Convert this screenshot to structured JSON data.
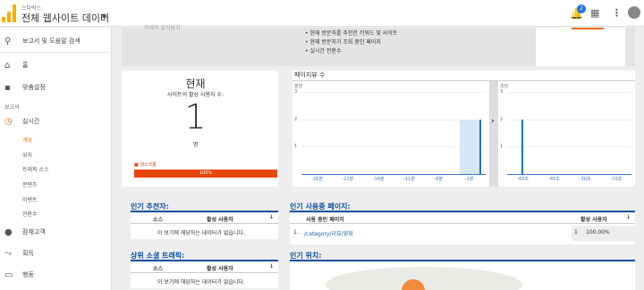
{
  "header": {
    "account_small": "스타벅스",
    "account_name": "전체 웹사이트 데이터",
    "notification_count": "2"
  },
  "sidebar": {
    "search_label": "보고서 및 도움말 검색",
    "home_label": "홈",
    "custom_label": "맞춤설정",
    "reports_heading": "보고서",
    "realtime_label": "실시간",
    "realtime_subs": [
      "개요",
      "위치",
      "트래픽 소스",
      "콘텐츠",
      "이벤트",
      "전환수"
    ],
    "audience_label": "잠재고객",
    "acquisition_label": "획득",
    "behavior_label": "행동"
  },
  "top_panel": {
    "gray_link": "자세히 알아보기",
    "bullets": [
      "현재 방문자를 추천한 키워드 및 사이트",
      "현재 방문자가 조회 중인 페이지",
      "실시간 전환수"
    ]
  },
  "now_card": {
    "title": "현재",
    "subtitle": "사이트의 활성 사용자 수:",
    "count": "1",
    "unit": "명",
    "device_label": "데스크톱",
    "device_percent": "100%",
    "device_fill": 1.0
  },
  "pageviews": {
    "title": "페이지뷰 수",
    "left_label": "분당",
    "right_label": "초당",
    "left_y": [
      "3",
      "2",
      "1"
    ],
    "right_y": [
      "3",
      "2",
      "1"
    ],
    "left_x": [
      "-26분",
      "-21분",
      "-16분",
      "-11분",
      "-6분",
      "-1분"
    ],
    "right_x": [
      "-60초",
      "-45초",
      "-30초",
      "-15초"
    ],
    "expand_glyph": "›"
  },
  "chart_data": [
    {
      "type": "bar",
      "title": "페이지뷰 수",
      "subtitle": "분당",
      "x": [
        "-26분",
        "-21분",
        "-16분",
        "-11분",
        "-6분",
        "-1분"
      ],
      "values": [
        0,
        0,
        0,
        0,
        0,
        2
      ],
      "ylim": [
        0,
        3
      ]
    },
    {
      "type": "bar",
      "title": "",
      "subtitle": "초당",
      "x": [
        "-60초",
        "-45초",
        "-30초",
        "-15초"
      ],
      "values": [
        2,
        0,
        0,
        0
      ],
      "ylim": [
        0,
        3
      ]
    }
  ],
  "top_referrers": {
    "title": "인기 추천자:",
    "col_source": "소스",
    "col_users": "활성 사용자",
    "empty": "이 보기에 해당하는 데이터가 없습니다."
  },
  "top_social": {
    "title": "상위 소셜 트래픽:",
    "col_source": "소스",
    "col_users": "활성 사용자",
    "empty": "이 보기에 해당하는 데이터가 없습니다."
  },
  "active_pages": {
    "title": "인기 사용중 페이지:",
    "col_page": "사용 중인 페이지",
    "col_users": "활성 사용자",
    "rows": [
      {
        "index": "1.",
        "page": "/category/리뷰/영화",
        "users": "1",
        "percent": "100.00%"
      }
    ]
  },
  "locations": {
    "title": "인기 위치:"
  }
}
